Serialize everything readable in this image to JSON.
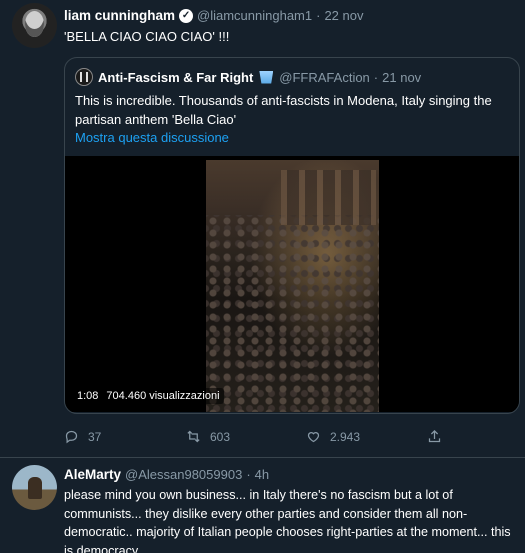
{
  "main_tweet": {
    "name": "liam cunningham",
    "handle": "@liamcunningham1",
    "time": "22 nov",
    "text": "'BELLA CIAO CIAO CIAO' !!!",
    "quote": {
      "name": "Anti-Fascism & Far Right",
      "handle": "@FFRAFAction",
      "time": "21 nov",
      "text": "This is incredible. Thousands of anti-fascists in Modena, Italy singing the partisan anthem 'Bella Ciao'",
      "show_thread": "Mostra questa discussione",
      "video": {
        "duration": "1:08",
        "views": "704.460 visualizzazioni"
      }
    },
    "actions": {
      "replies": "37",
      "retweets": "603",
      "likes": "2.943"
    }
  },
  "reply_tweet": {
    "name": "AleMarty",
    "handle": "@Alessan98059903",
    "time": "4h",
    "text": "please mind you own business... in Italy there's no fascism but a lot of communists... they dislike every other parties and consider them all non-democratic..  majority of Italian people chooses right-parties at the moment... this is democracy"
  },
  "colors": {
    "background": "#15202b",
    "secondary_text": "#8899a6",
    "link": "#1da1f2",
    "border": "#38444d"
  },
  "icons": [
    "verified-icon",
    "glass-icon",
    "reply-icon",
    "retweet-icon",
    "like-icon",
    "share-icon"
  ]
}
